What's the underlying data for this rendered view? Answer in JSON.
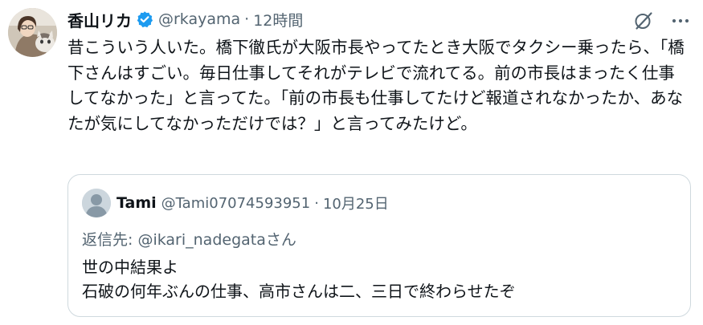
{
  "tweet": {
    "author": {
      "display_name": "香山リカ",
      "verified": true,
      "handle": "@rkayama",
      "avatar_icon": "avatar-photo-with-cat"
    },
    "separator": "·",
    "time": "12時間",
    "actions": {
      "grok_icon": "grok-icon",
      "more_icon": "more-icon"
    },
    "text": "昔こういう人いた。橋下徹氏が大阪市長やってたとき大阪でタクシー乗ったら、「橋下さんはすごい。毎日仕事してそれがテレビで流れてる。前の市長はまったく仕事してなかった」と言ってた。「前の市長も仕事してたけど報道されなかったか、あなたが気にしてなかっただけでは？」と言ってみたけど。"
  },
  "quote": {
    "author": {
      "display_name": "Tami",
      "handle": "@Tami07074593951",
      "avatar_icon": "default-avatar-icon"
    },
    "separator": "·",
    "time": "10月25日",
    "reply_prefix": "返信先: ",
    "reply_to": "@ikari_nadegataさん",
    "lines": [
      "世の中結果よ",
      "石破の何年ぶんの仕事、高市さんは二、三日で終わらせたぞ"
    ]
  },
  "colors": {
    "text": "#0f1419",
    "secondary": "#536471",
    "border": "#cfd9de",
    "verified": "#1d9bf0"
  }
}
